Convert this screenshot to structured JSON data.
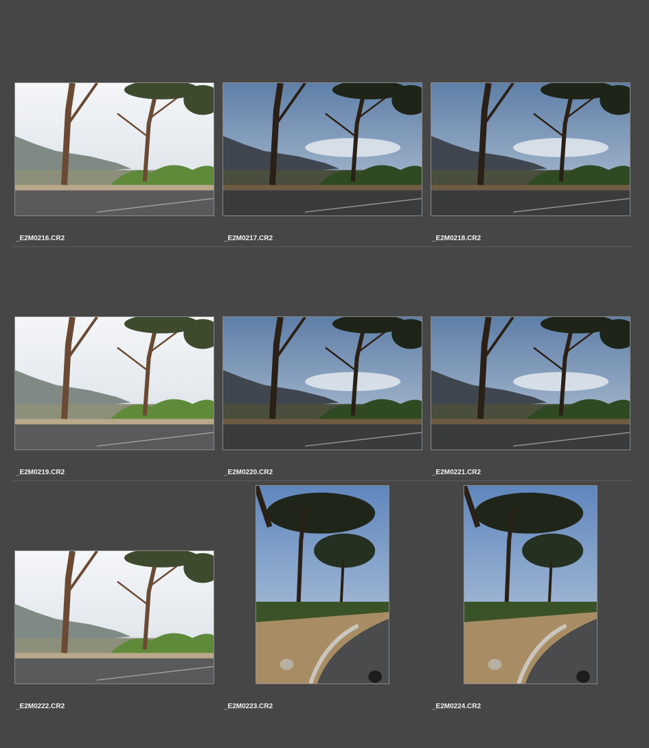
{
  "thumbnails": [
    {
      "filename": "_E2M0216.CR2",
      "orientation": "landscape",
      "exposure": "bright"
    },
    {
      "filename": "_E2M0217.CR2",
      "orientation": "landscape",
      "exposure": "normal"
    },
    {
      "filename": "_E2M0218.CR2",
      "orientation": "landscape",
      "exposure": "normal"
    },
    {
      "filename": "_E2M0219.CR2",
      "orientation": "landscape",
      "exposure": "bright"
    },
    {
      "filename": "_E2M0220.CR2",
      "orientation": "landscape",
      "exposure": "normal"
    },
    {
      "filename": "_E2M0221.CR2",
      "orientation": "landscape",
      "exposure": "normal"
    },
    {
      "filename": "_E2M0222.CR2",
      "orientation": "landscape",
      "exposure": "bright"
    },
    {
      "filename": "_E2M0223.CR2",
      "orientation": "portrait",
      "exposure": "normal"
    },
    {
      "filename": "_E2M0224.CR2",
      "orientation": "portrait",
      "exposure": "normal"
    }
  ],
  "colors": {
    "background": "#464646",
    "separator": "#5c5c5c",
    "thumb_border": "#8a8a8a",
    "label": "#f2f2f2"
  }
}
